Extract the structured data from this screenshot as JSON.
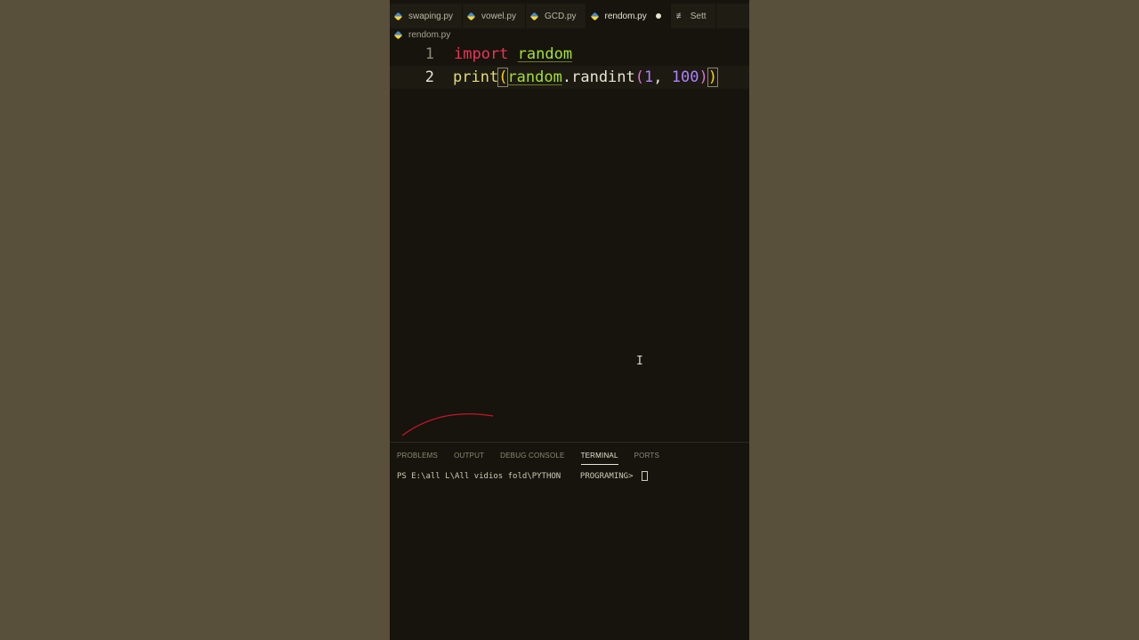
{
  "tabs": [
    {
      "label": "swaping.py",
      "icon": "python-file-icon",
      "active": false
    },
    {
      "label": "vowel.py",
      "icon": "python-file-icon",
      "active": false
    },
    {
      "label": "GCD.py",
      "icon": "python-file-icon",
      "active": false
    },
    {
      "label": "rendom.py",
      "icon": "python-file-icon",
      "active": true,
      "dirty": true
    },
    {
      "label": "Sett",
      "icon": "settings-icon",
      "active": false
    }
  ],
  "breadcrumb": {
    "file": "rendom.py"
  },
  "code": {
    "line1": {
      "number": "1",
      "kw": "import",
      "module": "random"
    },
    "line2": {
      "number": "2",
      "fn": "print",
      "module": "random",
      "dot": ".",
      "method": "randint",
      "arg1": "1",
      "comma": ", ",
      "arg2": "100"
    }
  },
  "panel": {
    "tabs": [
      "PROBLEMS",
      "OUTPUT",
      "DEBUG CONSOLE",
      "TERMINAL",
      "PORTS"
    ],
    "active_tab": "TERMINAL",
    "terminal_prompt": "PS E:\\all L\\All vidios fold\\PYTHON    PROGRAMING> "
  },
  "colors": {
    "keyword": "#f0325a",
    "module": "#a6e22e",
    "function": "#e6db74",
    "number": "#ae81ff",
    "background": "#16140c"
  }
}
